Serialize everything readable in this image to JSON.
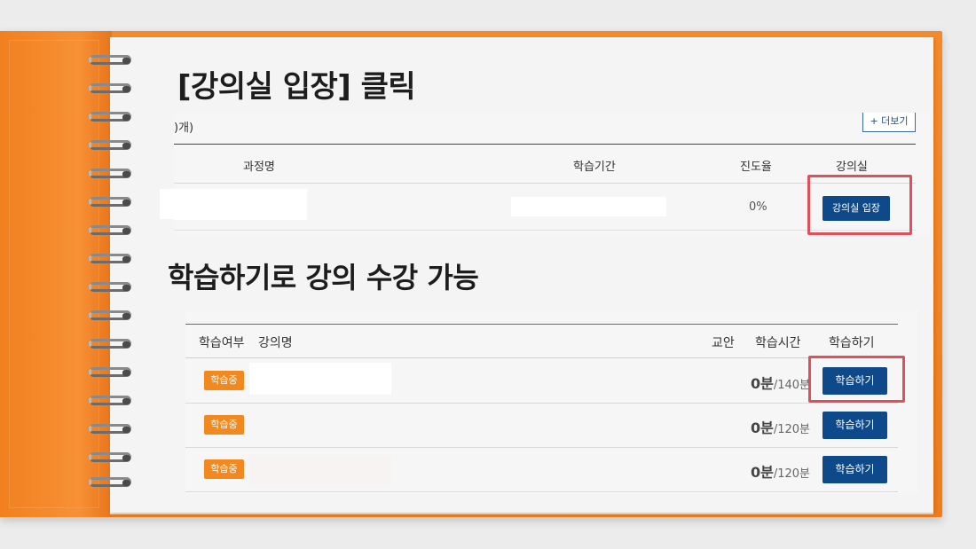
{
  "heading_top": "[강의실 입장] 클릭",
  "heading_bottom": "학습하기로 강의 수강 가능",
  "course_table": {
    "count_label": ")개)",
    "more_button": "+ 더보기",
    "headers": [
      "과정명",
      "학습기간",
      "진도율",
      "강의실"
    ],
    "row": {
      "progress": "0%",
      "enter_button": "강의실 입장"
    }
  },
  "lecture_table": {
    "headers": {
      "status": "학습여부",
      "name": "강의명",
      "material": "교안",
      "time": "학습시간",
      "action": "학습하기"
    },
    "rows": [
      {
        "status": "학습중",
        "studied": "0분",
        "total": "/140분",
        "button": "학습하기"
      },
      {
        "status": "학습중",
        "studied": "0분",
        "total": "/120분",
        "button": "학습하기"
      },
      {
        "status": "학습중",
        "studied": "0분",
        "total": "/120분",
        "button": "학습하기"
      }
    ]
  },
  "colors": {
    "cover": "#f58a2a",
    "button": "#0e4a8a",
    "badge": "#f2891f",
    "highlight": "#e0505a"
  }
}
